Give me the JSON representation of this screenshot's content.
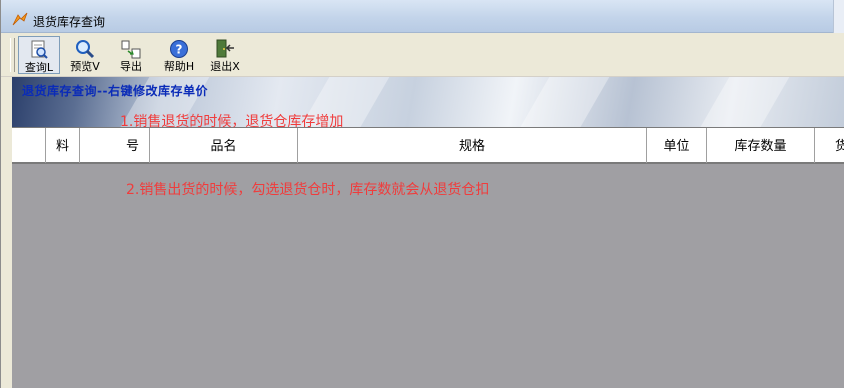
{
  "window": {
    "title": "退货库存查询"
  },
  "toolbar": {
    "buttons": [
      {
        "label": "查询L",
        "icon": "query-document-icon"
      },
      {
        "label": "预览V",
        "icon": "magnifier-icon"
      },
      {
        "label": "导出",
        "icon": "export-icon"
      },
      {
        "label": "帮助H",
        "icon": "help-icon"
      },
      {
        "label": "退出X",
        "icon": "exit-door-icon"
      }
    ]
  },
  "banner": {
    "heading": "退货库存查询--右键修改库存单价"
  },
  "annotations": {
    "note1": "1.销售退货的时候，退货仓库存增加",
    "note2": "2.销售出货的时候，勾选退货仓时，库存数就会从退货仓扣"
  },
  "grid": {
    "columns": [
      "料",
      "号",
      "品名",
      "规格",
      "单位",
      "库存数量",
      "货"
    ]
  },
  "colors": {
    "annotation": "#f03c3c",
    "banner_heading": "#0a2bb8",
    "grid_background": "#a09fa3"
  }
}
